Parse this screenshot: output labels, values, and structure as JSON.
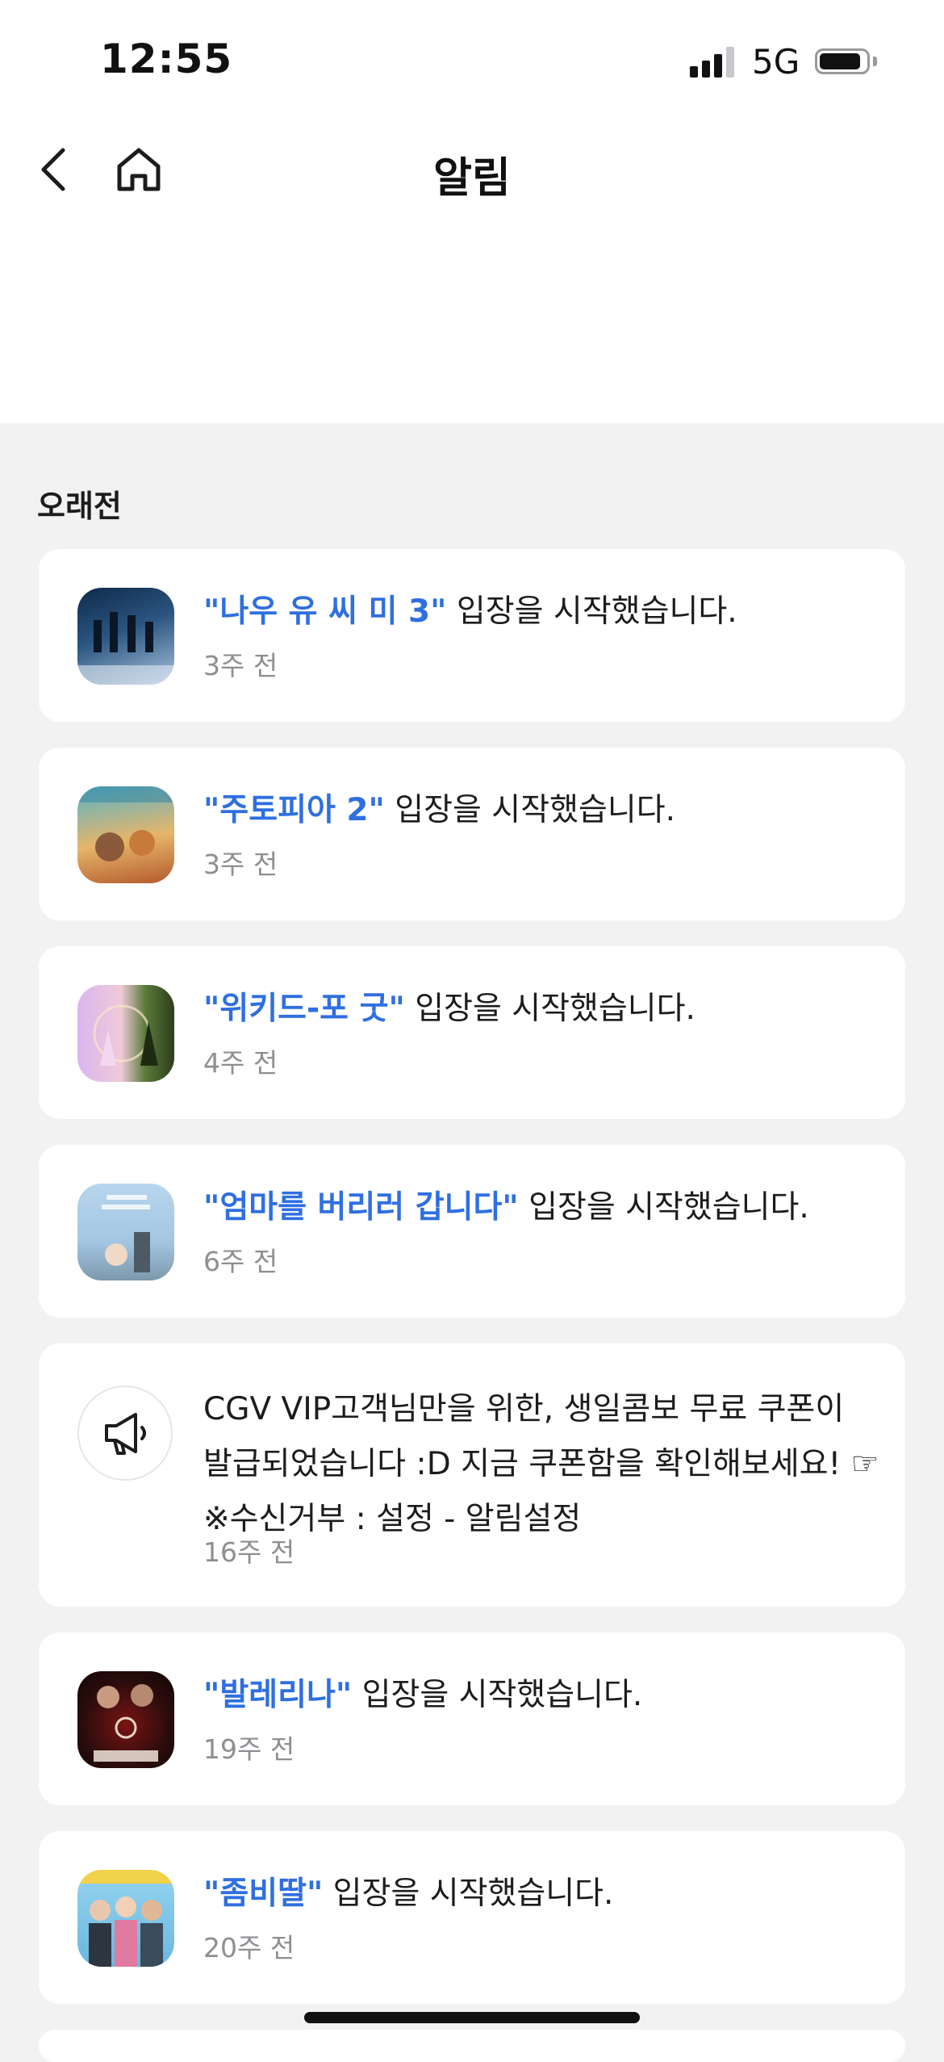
{
  "status_bar": {
    "time": "12:55",
    "network": "5G"
  },
  "header": {
    "title": "알림",
    "back_icon": "chevron-left-icon",
    "home_icon": "home-icon"
  },
  "section": {
    "label": "오래전"
  },
  "notifications": [
    {
      "title": "\"나우 유 씨 미 3\"",
      "message": " 입장을 시작했습니다.",
      "time": "3주 전",
      "thumb_colors": [
        "#1f3d63",
        "#6b8bb0"
      ]
    },
    {
      "title": "\"주토피아 2\"",
      "message": " 입장을 시작했습니다.",
      "time": "3주 전",
      "thumb_colors": [
        "#4fa2b8",
        "#d98a4a"
      ]
    },
    {
      "title": "\"위키드-포 굿\"",
      "message": " 입장을 시작했습니다.",
      "time": "4주 전",
      "thumb_colors": [
        "#c99be0",
        "#3f6b2e"
      ]
    },
    {
      "title": "\"엄마를 버리러 갑니다\"",
      "message": " 입장을 시작했습니다.",
      "time": "6주 전",
      "thumb_colors": [
        "#9dc4e3",
        "#6f8a9e"
      ]
    },
    {
      "title": "\"발레리나\"",
      "message": " 입장을 시작했습니다.",
      "time": "19주 전",
      "thumb_colors": [
        "#2a0e0e",
        "#9e1f1f"
      ]
    },
    {
      "title": "\"좀비딸\"",
      "message": " 입장을 시작했습니다.",
      "time": "20주 전",
      "thumb_colors": [
        "#7fc7e8",
        "#f2d24a"
      ]
    }
  ],
  "promo": {
    "icon": "megaphone-icon",
    "lines": [
      "CGV VIP고객님만을 위한, 생일콤보 무료 쿠폰이",
      "발급되었습니다 :D 지금 쿠폰함을 확인해보세요! ☞",
      "※수신거부 : 설정 - 알림설정"
    ],
    "time": "16주 전"
  },
  "colors": {
    "accent": "#2f6fe0",
    "background": "#f2f2f3",
    "card": "#ffffff",
    "muted_text": "#8e8e93"
  }
}
